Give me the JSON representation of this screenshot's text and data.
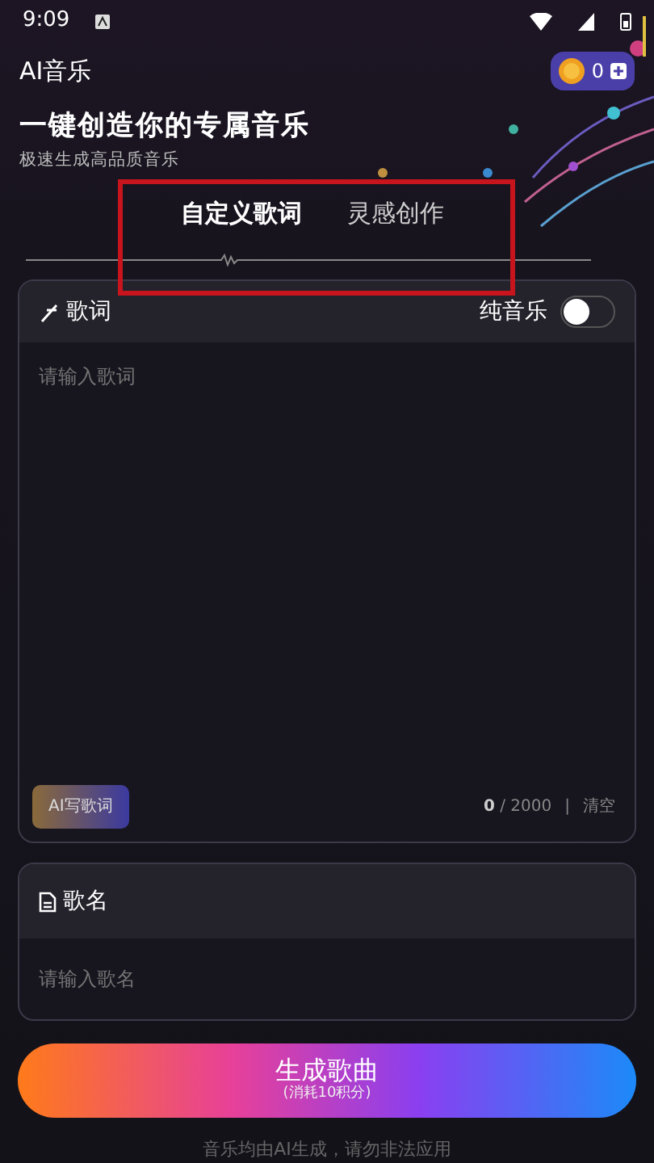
{
  "status_bar": {
    "time": "9:09"
  },
  "header": {
    "title": "AI音乐",
    "coins": "0",
    "headline": "一键创造你的专属音乐",
    "subtitle": "极速生成高品质音乐"
  },
  "tabs": [
    {
      "label": "自定义歌词",
      "selected": true
    },
    {
      "label": "灵感创作",
      "selected": false
    }
  ],
  "lyrics": {
    "title": "歌词",
    "toggle_label": "纯音乐",
    "toggle_on": false,
    "placeholder": "请输入歌词",
    "ai_button": "AI写歌词",
    "count": "0",
    "limit": "/ 2000",
    "separator": "|",
    "clear": "清空"
  },
  "song_name": {
    "title": "歌名",
    "placeholder": "请输入歌名"
  },
  "generate": {
    "label": "生成歌曲",
    "cost": "(消耗10积分)"
  },
  "footer": "音乐均由AI生成，请勿非法应用"
}
